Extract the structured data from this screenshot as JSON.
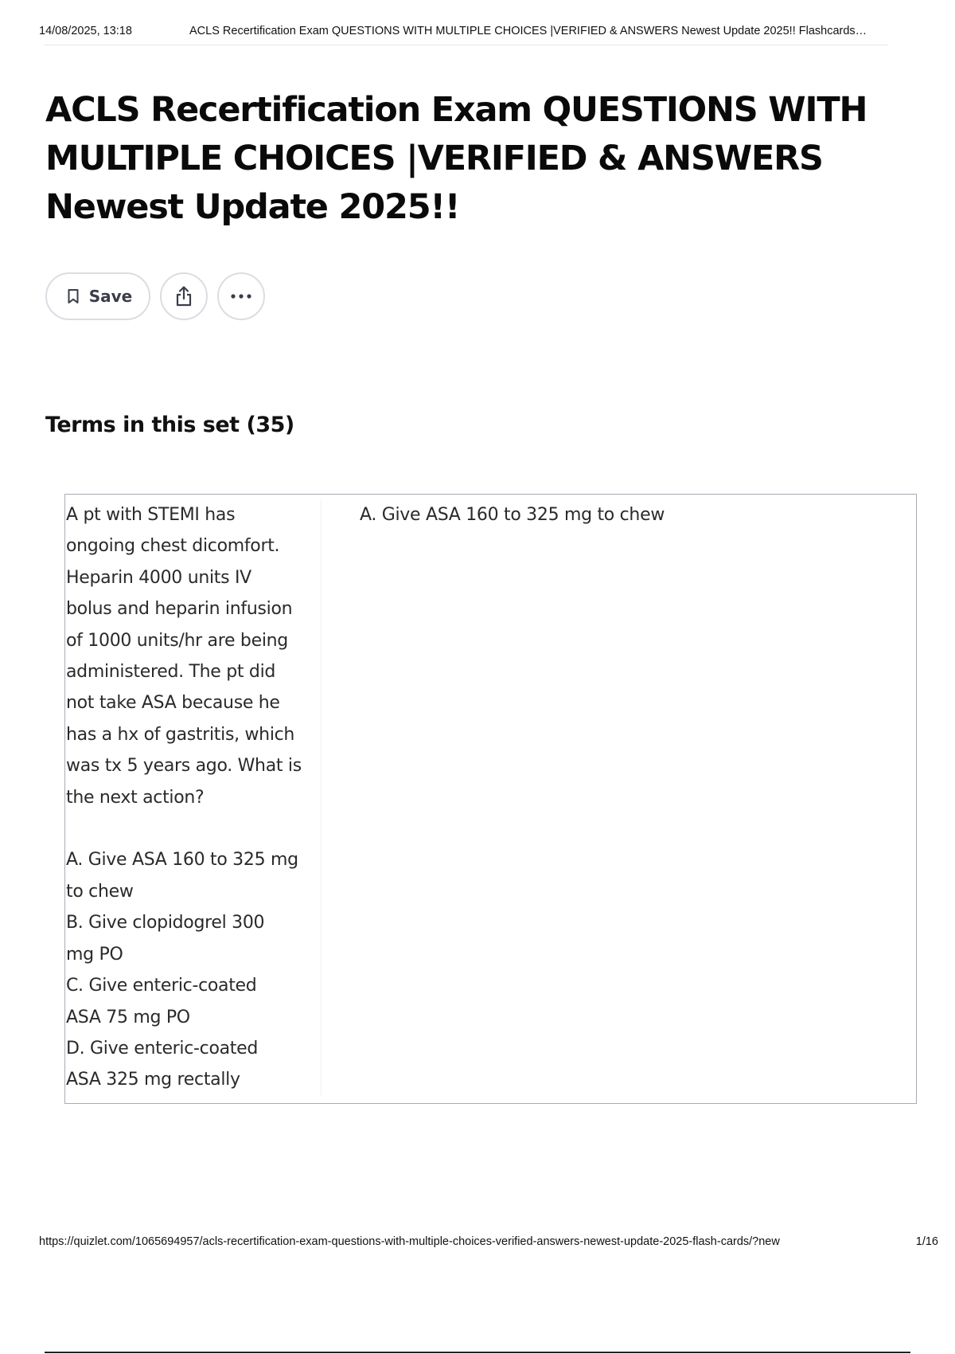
{
  "print_header": {
    "date": "14/08/2025, 13:18",
    "title": "ACLS Recertification Exam QUESTIONS WITH MULTIPLE CHOICES |VERIFIED & ANSWERS Newest Update 2025!! Flashcards…"
  },
  "page": {
    "title": "ACLS Recertification Exam QUESTIONS WITH MULTIPLE CHOICES |VERIFIED & ANSWERS Newest Update 2025!!"
  },
  "actions": {
    "save_label": "Save",
    "save_icon": "bookmark-icon",
    "share_icon": "share-icon",
    "more_icon": "more-options-icon"
  },
  "terms_section": {
    "heading": "Terms in this set (35)"
  },
  "terms": [
    {
      "term": "A pt with STEMI has\nongoing chest dicomfort.\nHeparin 4000 units IV\nbolus and heparin infusion\nof 1000 units/hr are being\nadministered. The pt did\nnot take ASA because he\nhas a hx of gastritis, which\nwas tx 5 years ago. What is\nthe next action?\n\nA. Give ASA 160 to 325 mg\nto chew\nB. Give clopidogrel 300\nmg PO\nC. Give enteric-coated\nASA 75 mg PO\nD. Give enteric-coated\nASA 325 mg rectally",
      "definition": "A. Give ASA 160 to 325 mg to chew"
    }
  ],
  "print_footer": {
    "url": "https://quizlet.com/1065694957/acls-recertification-exam-questions-with-multiple-choices-verified-answers-newest-update-2025-flash-cards/?new",
    "page_number": "1/16"
  },
  "colors": {
    "button_border": "#dcdde3",
    "button_text": "#3a3d4a",
    "card_border": "#a9abb4",
    "text": "#2a2a2a"
  }
}
